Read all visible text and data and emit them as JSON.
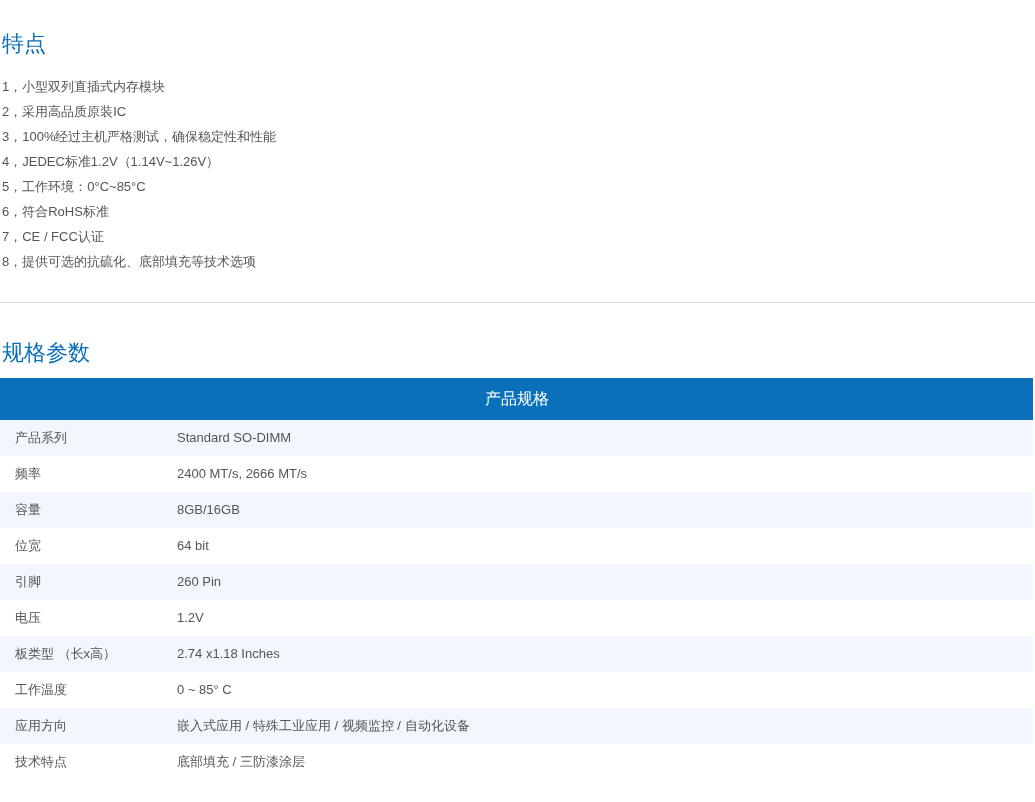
{
  "features": {
    "title": "特点",
    "items": [
      "1，小型双列直插式内存模块",
      "2，采用高品质原装IC",
      "3，100%经过主机严格测试，确保稳定性和性能",
      "4，JEDEC标准1.2V（1.14V~1.26V）",
      "5，工作环境：0°C~85°C",
      "6，符合RoHS标准",
      "7，CE / FCC认证",
      "8，提供可选的抗硫化、底部填充等技术选项"
    ]
  },
  "specs": {
    "title": "规格参数",
    "table": {
      "header": "产品规格",
      "rows": [
        {
          "label": "产品系列",
          "value": "Standard SO-DIMM"
        },
        {
          "label": "频率",
          "value": "2400 MT/s, 2666 MT/s"
        },
        {
          "label": "容量",
          "value": "8GB/16GB"
        },
        {
          "label": "位宽",
          "value": "64 bit"
        },
        {
          "label": "引脚",
          "value": "260 Pin"
        },
        {
          "label": "电压",
          "value": "1.2V"
        },
        {
          "label": "板类型 （长x高）",
          "value": "2.74 x1.18 Inches"
        },
        {
          "label": "工作温度",
          "value": "0 ~ 85° C"
        },
        {
          "label": "应用方向",
          "value": "嵌入式应用 / 特殊工业应用 / 视频监控 / 自动化设备"
        },
        {
          "label": "技术特点",
          "value": "底部填充 / 三防漆涂层"
        }
      ]
    }
  }
}
